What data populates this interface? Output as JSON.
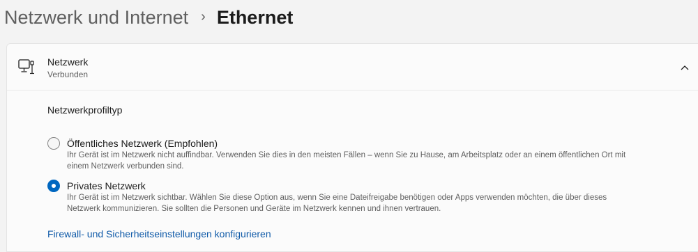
{
  "breadcrumb": {
    "parent": "Netzwerk und Internet",
    "separator": "›",
    "current": "Ethernet"
  },
  "network_card": {
    "icon": "network-pc-icon",
    "title": "Netzwerk",
    "status": "Verbunden",
    "collapse_icon": "chevron-up-icon"
  },
  "profile": {
    "section_title": "Netzwerkprofiltyp",
    "options": [
      {
        "title": "Öffentliches Netzwerk (Empfohlen)",
        "desc_line1": "Ihr Gerät ist im Netzwerk nicht auffindbar. Verwenden Sie dies in den meisten Fällen – wenn Sie zu Hause, am Arbeitsplatz oder an einem öffentlichen Ort mit",
        "desc_line2": "einem Netzwerk verbunden sind.",
        "selected": false
      },
      {
        "title": "Privates Netzwerk",
        "desc_line1": "Ihr Gerät ist im Netzwerk sichtbar. Wählen Sie diese Option aus, wenn Sie eine Dateifreigabe benötigen oder Apps verwenden möchten, die über dieses",
        "desc_line2": "Netzwerk kommunizieren. Sie sollten die Personen und Geräte im Netzwerk kennen und ihnen vertrauen.",
        "selected": true
      }
    ]
  },
  "firewall_link": "Firewall- und Sicherheitseinstellungen konfigurieren",
  "colors": {
    "accent": "#0067c0",
    "link": "#0f5aa8"
  }
}
